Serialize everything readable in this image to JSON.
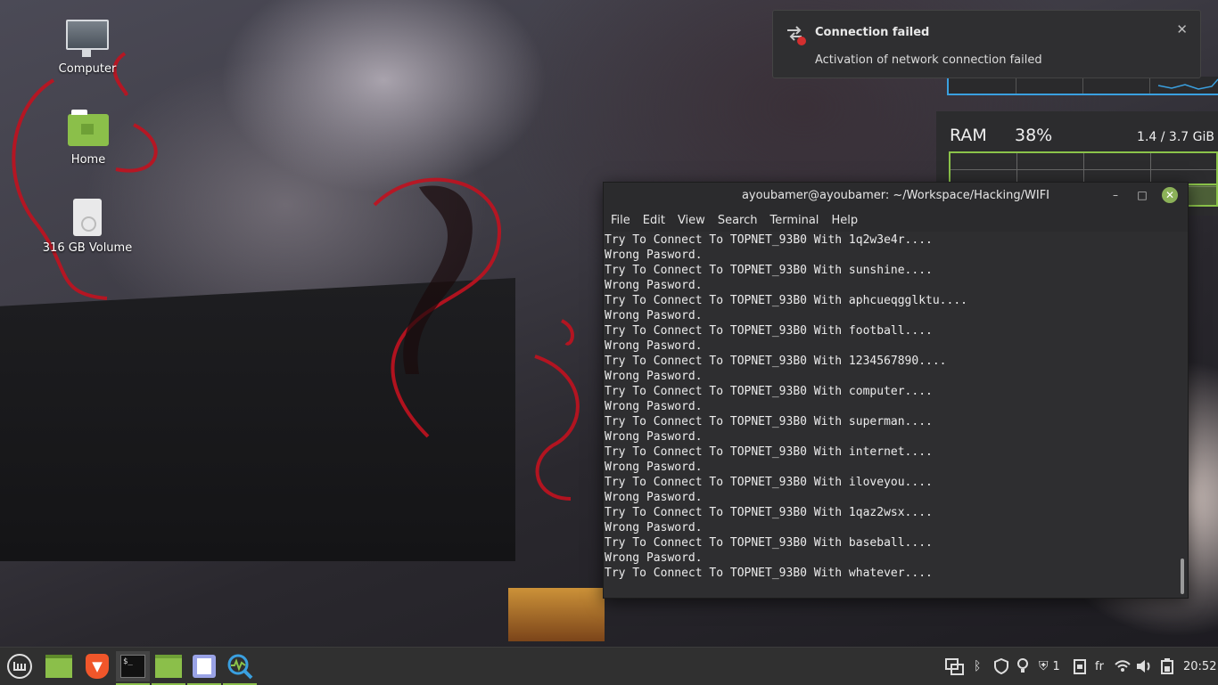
{
  "desktop": {
    "icons": [
      {
        "label": "Computer"
      },
      {
        "label": "Home"
      },
      {
        "label": "316 GB Volume"
      }
    ]
  },
  "notification": {
    "title": "Connection failed",
    "message": "Activation of network connection failed",
    "close_glyph": "✕",
    "icon": "network-error-icon"
  },
  "conky": {
    "ram_label": "RAM",
    "ram_percent": "38%",
    "ram_usage": "1.4 / 3.7 GiB",
    "ram_fraction": 0.38,
    "accent_color": "#8bc34a",
    "net_color": "#3aa0e0"
  },
  "terminal": {
    "title": "ayoubamer@ayoubamer: ~/Workspace/Hacking/WIFI",
    "menu": [
      "File",
      "Edit",
      "View",
      "Search",
      "Terminal",
      "Help"
    ],
    "lines": [
      "Try To Connect To TOPNET_93B0 With 1q2w3e4r....",
      "Wrong Pasword.",
      "Try To Connect To TOPNET_93B0 With sunshine....",
      "Wrong Pasword.",
      "Try To Connect To TOPNET_93B0 With aphcueqgglktu....",
      "Wrong Pasword.",
      "Try To Connect To TOPNET_93B0 With football....",
      "Wrong Pasword.",
      "Try To Connect To TOPNET_93B0 With 1234567890....",
      "Wrong Pasword.",
      "Try To Connect To TOPNET_93B0 With computer....",
      "Wrong Pasword.",
      "Try To Connect To TOPNET_93B0 With superman....",
      "Wrong Pasword.",
      "Try To Connect To TOPNET_93B0 With internet....",
      "Wrong Pasword.",
      "Try To Connect To TOPNET_93B0 With iloveyou....",
      "Wrong Pasword.",
      "Try To Connect To TOPNET_93B0 With 1qaz2wsx....",
      "Wrong Pasword.",
      "Try To Connect To TOPNET_93B0 With baseball....",
      "Wrong Pasword.",
      "Try To Connect To TOPNET_93B0 With whatever...."
    ],
    "buttons": {
      "minimize": "–",
      "maximize": "□",
      "close": "✕"
    }
  },
  "taskbar": {
    "apps": [
      {
        "name": "menu-icon"
      },
      {
        "name": "show-desktop-icon"
      },
      {
        "name": "brave-browser-icon"
      },
      {
        "name": "terminal-icon"
      },
      {
        "name": "files-icon"
      },
      {
        "name": "text-editor-icon"
      },
      {
        "name": "system-monitor-icon"
      }
    ],
    "tray": {
      "updates_count": "1",
      "keyboard_layout": "fr",
      "clock": "20:52"
    },
    "accent_color": "#8bbf4a"
  }
}
